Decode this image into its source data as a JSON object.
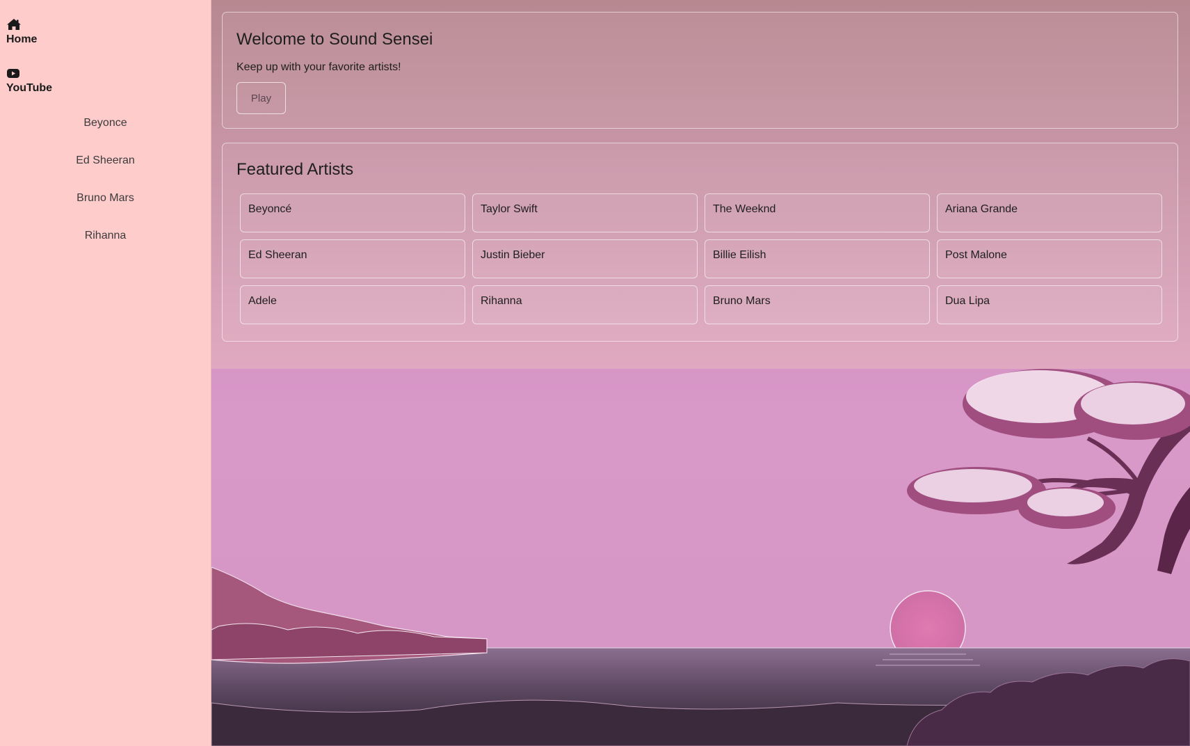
{
  "sidebar": {
    "nav": [
      {
        "label": "Home",
        "icon": "home-icon"
      },
      {
        "label": "YouTube",
        "icon": "youtube-icon"
      }
    ],
    "artists": [
      "Beyonce",
      "Ed Sheeran",
      "Bruno Mars",
      "Rihanna"
    ]
  },
  "welcome": {
    "title": "Welcome to Sound Sensei",
    "subtitle": "Keep up with your favorite artists!",
    "play_label": "Play"
  },
  "featured": {
    "title": "Featured Artists",
    "artists": [
      "Beyoncé",
      "Taylor Swift",
      "The Weeknd",
      "Ariana Grande",
      "Ed Sheeran",
      "Justin Bieber",
      "Billie Eilish",
      "Post Malone",
      "Adele",
      "Rihanna",
      "Bruno Mars",
      "Dua Lipa"
    ]
  },
  "colors": {
    "sidebar_bg": "#ffcccc",
    "sky_top": "#c27db3",
    "sky_mid": "#d898c8",
    "sea": "#5e4a63",
    "blossom": "#f7e7f3",
    "branch": "#6a2f55"
  }
}
